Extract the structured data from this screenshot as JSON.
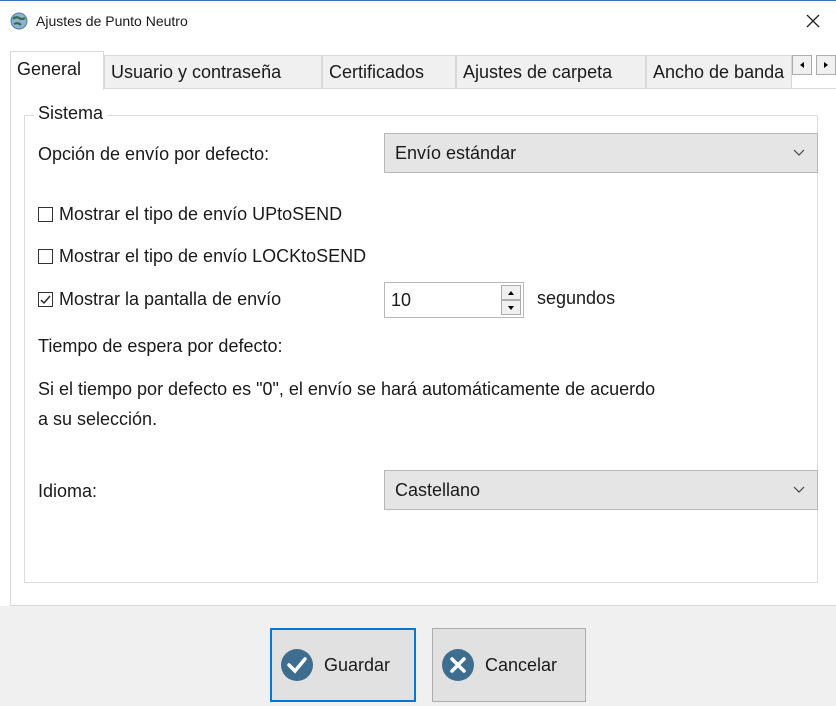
{
  "window": {
    "title": "Ajustes de Punto Neutro",
    "close_glyph": "✕"
  },
  "tabs": [
    {
      "label": "General",
      "active": true
    },
    {
      "label": "Usuario y contraseña",
      "active": false
    },
    {
      "label": "Certificados",
      "active": false
    },
    {
      "label": "Ajustes de carpeta",
      "active": false
    },
    {
      "label": "Ancho de banda",
      "active": false
    }
  ],
  "tab_scroll": {
    "left_glyph": "◂",
    "right_glyph": "▸"
  },
  "group": {
    "title": "Sistema",
    "send_option": {
      "label": "Opción de envío por defecto:",
      "value": "Envío estándar"
    },
    "checkboxes": [
      {
        "label": "Mostrar el tipo de envío UPtoSEND",
        "checked": false
      },
      {
        "label": "Mostrar el tipo de envío LOCKtoSEND",
        "checked": false
      },
      {
        "label": "Mostrar la pantalla de envío",
        "checked": true
      }
    ],
    "spinner": {
      "value": "10",
      "unit": "segundos"
    },
    "timeout_label": "Tiempo de espera por defecto:",
    "info_line1": "Si el tiempo por defecto es \"0\", el envío se hará automáticamente de acuerdo",
    "info_line2": "a su selección.",
    "language": {
      "label": "Idioma:",
      "value": "Castellano"
    }
  },
  "footer": {
    "save_label": "Guardar",
    "cancel_label": "Cancelar"
  },
  "colors": {
    "accent": "#0078d7",
    "icon_save": "#3d6e8f",
    "icon_cancel": "#3d6e8f"
  },
  "icons": {
    "app": "globe-icon",
    "close": "close-icon",
    "chevron": "chevron-down-icon",
    "save": "check-circle-icon",
    "cancel": "x-circle-icon"
  }
}
